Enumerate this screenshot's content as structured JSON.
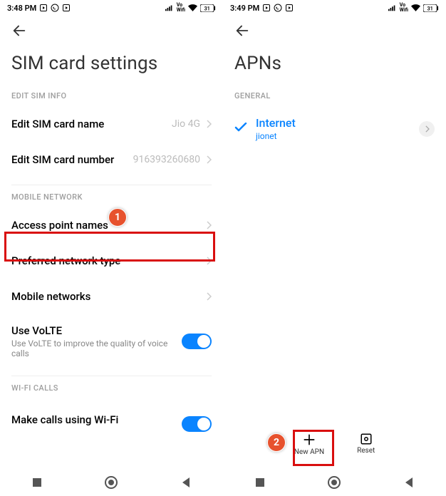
{
  "left": {
    "status": {
      "time": "3:48 PM",
      "battery": "31"
    },
    "title": "SIM card settings",
    "sections": {
      "edit_sim_info": {
        "header": "EDIT SIM INFO",
        "name_row": {
          "label": "Edit SIM card name",
          "value": "Jio 4G"
        },
        "number_row": {
          "label": "Edit SIM card number",
          "value": "916393260680"
        }
      },
      "mobile_network": {
        "header": "MOBILE NETWORK",
        "apn": {
          "label": "Access point names"
        },
        "pref": {
          "label": "Preferred network type"
        },
        "mobnet": {
          "label": "Mobile networks"
        },
        "volte": {
          "label": "Use VoLTE",
          "sub": "Use VoLTE to improve the quality of voice calls"
        }
      },
      "wifi_calls": {
        "header": "WI-FI CALLS",
        "wifi_call": {
          "label": "Make calls using Wi-Fi"
        }
      }
    }
  },
  "right": {
    "status": {
      "time": "3:49 PM",
      "battery": "31"
    },
    "title": "APNs",
    "general_header": "GENERAL",
    "apn": {
      "name": "Internet",
      "sub": "jionet"
    },
    "actions": {
      "new": "New APN",
      "reset": "Reset"
    }
  },
  "annotations": {
    "step1": "1",
    "step2": "2"
  }
}
